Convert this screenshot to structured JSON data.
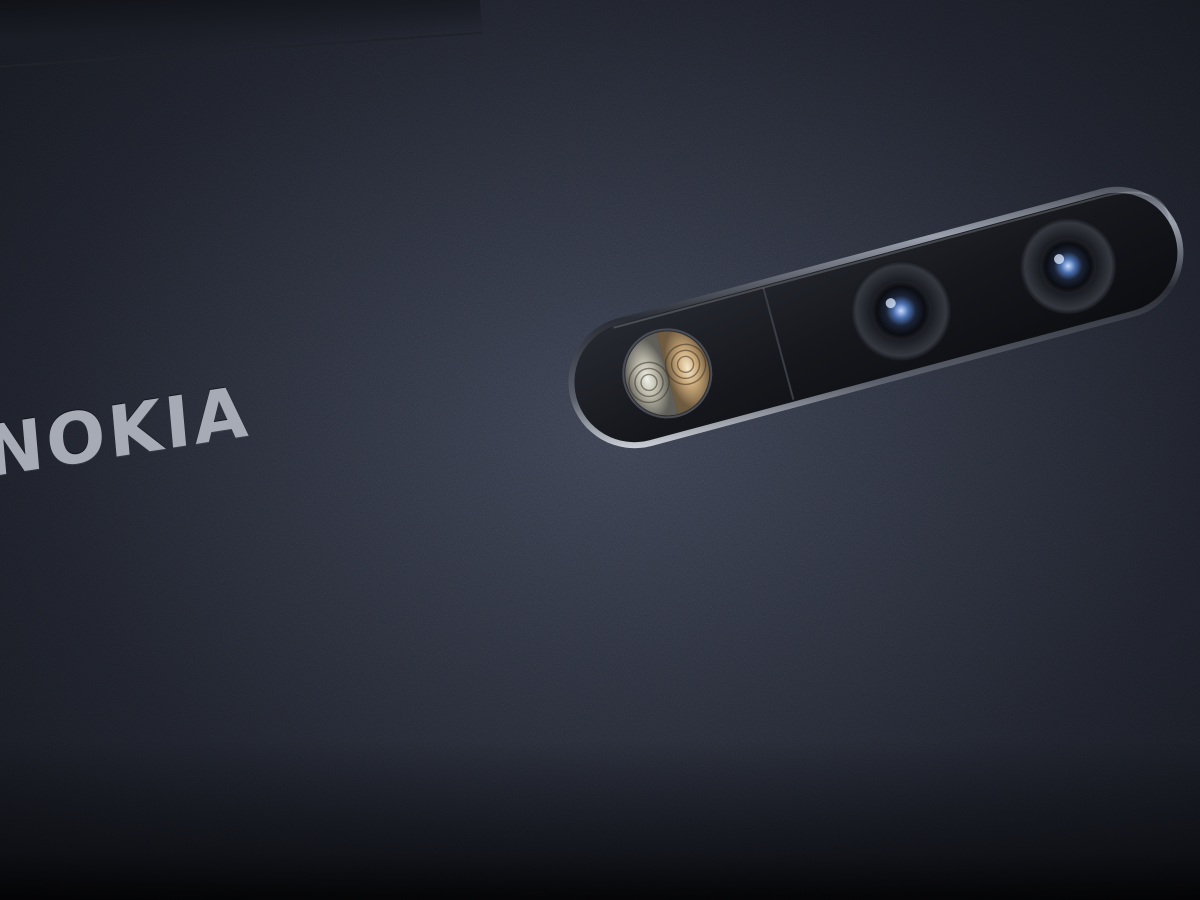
{
  "brand": {
    "logo_text": "NOKIA"
  },
  "colors": {
    "body": "#2b2f3b",
    "logo": "#a7abb6",
    "module": "#15171d",
    "rim": "#c9cdd6"
  },
  "camera_module": {
    "lenses": 2,
    "flash": "dual-tone-flash"
  }
}
